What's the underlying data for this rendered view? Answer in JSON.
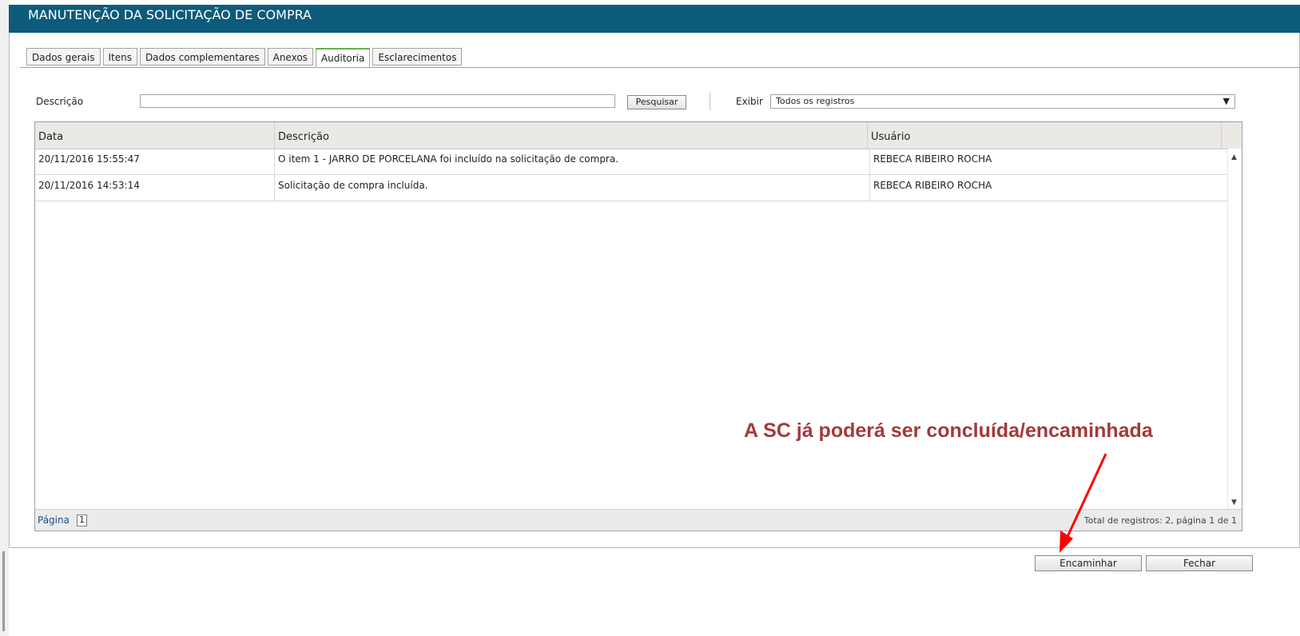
{
  "window": {
    "title": "MANUTENÇÃO DA SOLICITAÇÃO DE COMPRA"
  },
  "tabs": [
    {
      "label": "Dados gerais"
    },
    {
      "label": "Itens"
    },
    {
      "label": "Dados complementares"
    },
    {
      "label": "Anexos"
    },
    {
      "label": "Auditoria",
      "active": true
    },
    {
      "label": "Esclarecimentos"
    }
  ],
  "filter": {
    "description_label": "Descrição",
    "description_value": "",
    "search_button": "Pesquisar",
    "show_label": "Exibir",
    "show_selected": "Todos os registros"
  },
  "grid": {
    "columns": [
      "Data",
      "Descrição",
      "Usuário"
    ],
    "rows": [
      {
        "data": "20/11/2016 15:55:47",
        "descricao": "O item 1 - JARRO DE PORCELANA foi incluído na solicitação de compra.",
        "usuario": "REBECA RIBEIRO ROCHA"
      },
      {
        "data": "20/11/2016 14:53:14",
        "descricao": "Solicitação de compra incluída.",
        "usuario": "REBECA RIBEIRO ROCHA"
      }
    ],
    "page_label": "Página",
    "page_value": "1",
    "totals": "Total de registros: 2, página 1 de 1"
  },
  "actions": {
    "forward": "Encaminhar",
    "close": "Fechar"
  },
  "annotation": {
    "text": "A SC já poderá ser concluída/encaminhada",
    "color": "#a33a3a"
  },
  "colors": {
    "titlebar": "#0d5b7b",
    "active_tab_accent": "#66b04d",
    "arrow": "#ff0000"
  },
  "icons": {
    "scroll_up": "triangle-up",
    "scroll_down": "triangle-down",
    "dropdown": "triangle-down"
  }
}
